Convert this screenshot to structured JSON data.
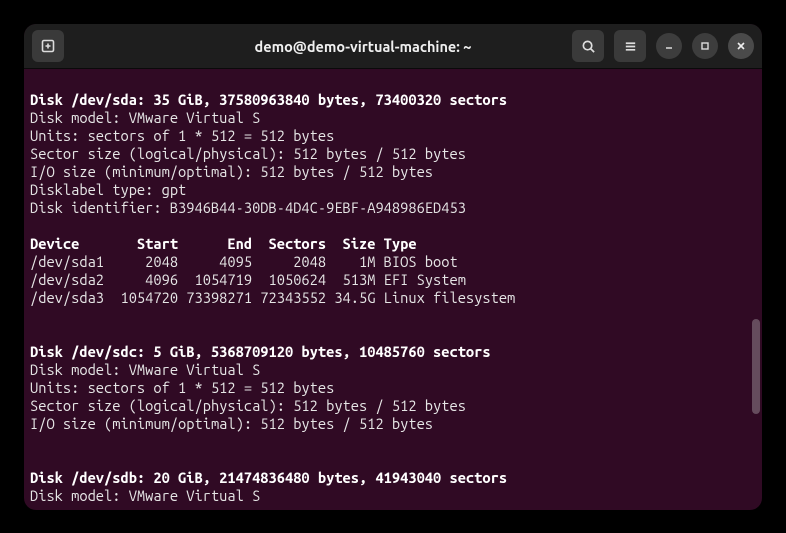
{
  "titlebar": {
    "title": "demo@demo-virtual-machine: ~"
  },
  "terminal": {
    "blank1": "",
    "sda_header": "Disk /dev/sda: 35 GiB, 37580963840 bytes, 73400320 sectors",
    "sda_model": "Disk model: VMware Virtual S",
    "sda_units": "Units: sectors of 1 * 512 = 512 bytes",
    "sda_sector": "Sector size (logical/physical): 512 bytes / 512 bytes",
    "sda_io": "I/O size (minimum/optimal): 512 bytes / 512 bytes",
    "sda_label": "Disklabel type: gpt",
    "sda_id": "Disk identifier: B3946B44-30DB-4D4C-9EBF-A948986ED453",
    "blank2": "",
    "table_header": "Device       Start      End  Sectors  Size Type",
    "row1": "/dev/sda1     2048     4095     2048    1M BIOS boot",
    "row2": "/dev/sda2     4096  1054719  1050624  513M EFI System",
    "row3": "/dev/sda3  1054720 73398271 72343552 34.5G Linux filesystem",
    "blank3": "",
    "blank4": "",
    "sdc_header": "Disk /dev/sdc: 5 GiB, 5368709120 bytes, 10485760 sectors",
    "sdc_model": "Disk model: VMware Virtual S",
    "sdc_units": "Units: sectors of 1 * 512 = 512 bytes",
    "sdc_sector": "Sector size (logical/physical): 512 bytes / 512 bytes",
    "sdc_io": "I/O size (minimum/optimal): 512 bytes / 512 bytes",
    "blank5": "",
    "blank6": "",
    "sdb_header": "Disk /dev/sdb: 20 GiB, 21474836480 bytes, 41943040 sectors",
    "sdb_model": "Disk model: VMware Virtual S"
  }
}
